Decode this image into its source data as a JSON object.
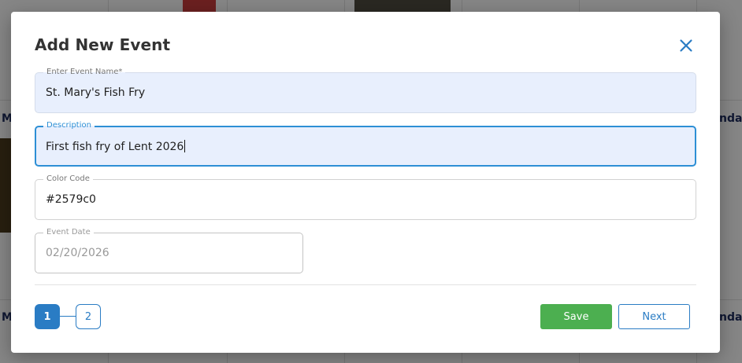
{
  "background": {
    "labels": [
      "M",
      "nda",
      "M",
      "nda"
    ]
  },
  "modal": {
    "title": "Add New Event",
    "close_icon": "close-icon",
    "fields": {
      "event_name": {
        "label": "Enter Event Name*",
        "value": "St. Mary's Fish Fry"
      },
      "description": {
        "label": "Description",
        "value": "First fish fry of Lent 2026"
      },
      "color_code": {
        "label": "Color Code",
        "value": "#2579c0"
      },
      "event_date": {
        "label": "Event Date",
        "value": "02/20/2026"
      }
    },
    "steps": [
      "1",
      "2"
    ],
    "active_step": "1",
    "buttons": {
      "save": "Save",
      "next": "Next"
    }
  },
  "colors": {
    "primary": "#2a7cc4",
    "focus": "#2d8fd5",
    "save": "#4caf50",
    "field_fill": "#e8effd"
  }
}
